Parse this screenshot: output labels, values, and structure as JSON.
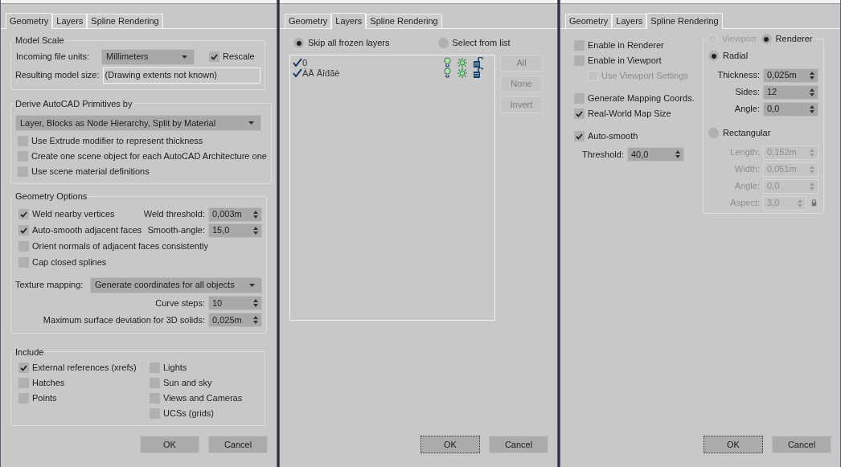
{
  "geometry_dialog": {
    "tabs": [
      {
        "label": "Geometry",
        "selected": true
      },
      {
        "label": "Layers",
        "selected": false
      },
      {
        "label": "Spline Rendering",
        "selected": false
      }
    ],
    "model_scale": {
      "title": "Model Scale",
      "units_label": "Incoming file units:",
      "units_value": "Millimeters",
      "rescale": {
        "label": "Rescale",
        "checked": true
      },
      "size_label": "Resulting model size:",
      "size_value": "(Drawing extents not known)"
    },
    "derive": {
      "title": "Derive AutoCAD Primitives by",
      "dropdown": "Layer, Blocks as Node Hierarchy, Split by Material",
      "checkboxes": [
        {
          "label": "Use Extrude modifier to represent thickness",
          "checked": false
        },
        {
          "label": "Create one scene object for each AutoCAD Architecture one",
          "checked": false
        },
        {
          "label": "Use scene material definitions",
          "checked": false
        }
      ]
    },
    "geometry_options": {
      "title": "Geometry Options",
      "checkboxes": [
        {
          "label": "Weld nearby vertices",
          "checked": true,
          "spinner_label": "Weld threshold:",
          "spinner_value": "0,003m"
        },
        {
          "label": "Auto-smooth adjacent faces",
          "checked": true,
          "spinner_label": "Smooth-angle:",
          "spinner_value": "15,0"
        },
        {
          "label": "Orient normals of adjacent faces consistently",
          "checked": false
        },
        {
          "label": "Cap closed splines",
          "checked": false
        }
      ],
      "texture_label": "Texture mapping:",
      "texture_value": "Generate coordinates for all objects",
      "spinners": [
        {
          "label": "Curve steps:",
          "value": "10"
        },
        {
          "label": "Maximum surface deviation for 3D solids:",
          "value": "0,025m"
        }
      ]
    },
    "include": {
      "title": "Include",
      "left": [
        {
          "label": "External references (xrefs)",
          "checked": true
        },
        {
          "label": "Hatches",
          "checked": false
        },
        {
          "label": "Points",
          "checked": false
        }
      ],
      "right": [
        {
          "label": "Lights",
          "checked": false
        },
        {
          "label": "Sun and sky",
          "checked": false
        },
        {
          "label": "Views and Cameras",
          "checked": false
        },
        {
          "label": "UCSs (grids)",
          "checked": false
        }
      ]
    },
    "buttons": [
      {
        "label": "OK",
        "focused": false
      },
      {
        "label": "Cancel",
        "focused": false
      }
    ]
  },
  "layers_dialog": {
    "tabs": [
      {
        "label": "Geometry",
        "selected": false
      },
      {
        "label": "Layers",
        "selected": true
      },
      {
        "label": "Spline Rendering",
        "selected": false
      }
    ],
    "options": [
      {
        "label": "Skip all frozen layers",
        "selected": true
      },
      {
        "label": "Select from list",
        "selected": false
      }
    ],
    "layers": [
      {
        "name": "0",
        "checked": true
      },
      {
        "name": "ÀÄ Äîđãè",
        "checked": true
      }
    ],
    "list_buttons": [
      {
        "label": "All",
        "disabled": true
      },
      {
        "label": "None",
        "disabled": true
      },
      {
        "label": "Invert",
        "disabled": true
      }
    ],
    "buttons": [
      {
        "label": "OK",
        "focused": true
      },
      {
        "label": "Cancel",
        "focused": false
      }
    ]
  },
  "spline_dialog": {
    "tabs": [
      {
        "label": "Geometry",
        "selected": false
      },
      {
        "label": "Layers",
        "selected": false
      },
      {
        "label": "Spline Rendering",
        "selected": true
      }
    ],
    "checkbox_groups": [
      {
        "items": [
          {
            "label": "Enable in Renderer",
            "checked": false,
            "disabled": false,
            "indented": false
          },
          {
            "label": "Enable in Viewport",
            "checked": false,
            "disabled": false,
            "indented": false
          },
          {
            "label": "Use Viewport Settings",
            "checked": false,
            "disabled": true,
            "indented": true
          }
        ]
      },
      {
        "items": [
          {
            "label": "Generate Mapping Coords.",
            "checked": false,
            "disabled": false,
            "indented": false
          },
          {
            "label": "Real-World Map Size",
            "checked": true,
            "disabled": false,
            "indented": false
          }
        ]
      },
      {
        "items": [
          {
            "label": "Auto-smooth",
            "checked": true,
            "disabled": false,
            "indented": false
          }
        ]
      }
    ],
    "threshold": {
      "label": "Threshold:",
      "value": "40,0"
    },
    "modes": [
      {
        "label": "Viewport",
        "selected": false,
        "disabled": true
      },
      {
        "label": "Renderer",
        "selected": true,
        "disabled": false
      }
    ],
    "shapes": [
      {
        "label": "Radial",
        "selected": true,
        "fields": [
          {
            "label": "Thickness:",
            "value": "0,025m",
            "disabled": false
          },
          {
            "label": "Sides:",
            "value": "12",
            "disabled": false
          },
          {
            "label": "Angle:",
            "value": "0,0",
            "disabled": false
          }
        ]
      },
      {
        "label": "Rectangular",
        "selected": false,
        "fields": [
          {
            "label": "Length:",
            "value": "0,152m",
            "disabled": true
          },
          {
            "label": "Width:",
            "value": "0,051m",
            "disabled": true
          },
          {
            "label": "Angle:",
            "value": "0,0",
            "disabled": true
          },
          {
            "label": "Aspect:",
            "value": "3,0",
            "disabled": true,
            "lock": true
          }
        ]
      }
    ],
    "buttons": [
      {
        "label": "OK",
        "focused": true
      },
      {
        "label": "Cancel",
        "focused": false
      }
    ]
  }
}
